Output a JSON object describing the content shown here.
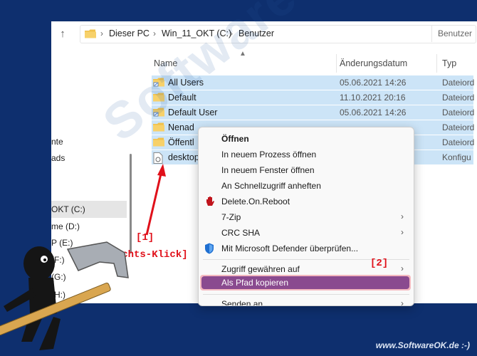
{
  "address": {
    "crumbs": [
      "Dieser PC",
      "Win_11_OKT (C:)",
      "Benutzer"
    ],
    "search_placeholder": "Benutzer"
  },
  "nav": {
    "items": [
      "nte",
      "ads",
      "OKT (C:)",
      "me (D:)",
      "P (E:)",
      "(F:)",
      "(G:)",
      "(H:)",
      ":)"
    ]
  },
  "columns": {
    "name": "Name",
    "date": "Änderungsdatum",
    "type": "Typ"
  },
  "files": [
    {
      "name": "All Users",
      "date": "05.06.2021 14:26",
      "type": "Dateiord",
      "icon": "folder-link-icon"
    },
    {
      "name": "Default",
      "date": "11.10.2021 20:16",
      "type": "Dateiord",
      "icon": "folder-icon"
    },
    {
      "name": "Default User",
      "date": "05.06.2021 14:26",
      "type": "Dateiord",
      "icon": "folder-link-icon"
    },
    {
      "name": "Nenad",
      "date": "",
      "type": "Dateiord",
      "icon": "folder-icon"
    },
    {
      "name": "Öffentl",
      "date": "",
      "type": "Dateiord",
      "icon": "folder-icon"
    },
    {
      "name": "desktop",
      "date": "",
      "type": "Konfigu",
      "icon": "settings-file-icon"
    }
  ],
  "context_menu": {
    "items": [
      {
        "label": "Öffnen",
        "bold": true
      },
      {
        "label": "In neuem Prozess öffnen"
      },
      {
        "label": "In neuem Fenster öffnen"
      },
      {
        "label": "An Schnellzugriff anheften"
      },
      {
        "label": "Delete.On.Reboot"
      },
      {
        "label": "7-Zip"
      },
      {
        "label": "CRC SHA"
      },
      {
        "label": "Mit Microsoft Defender überprüfen..."
      },
      {
        "label": "Zugriff gewähren auf"
      },
      {
        "label": "Als Pfad kopieren"
      },
      {
        "label": "Senden an"
      }
    ]
  },
  "annotations": {
    "step1": "[1]",
    "rechtsklick": "[Rechts-Klick]",
    "step2": "[2]"
  },
  "watermark": "SoftwareOK.de",
  "footer": "www.SoftwareOK.de :-)",
  "colors": {
    "selection": "#cce4f7",
    "highlight": "#8a4a8f",
    "highlight_border": "#f4b8bf",
    "annotation": "#e0101a",
    "background": "#0e2f6e"
  }
}
